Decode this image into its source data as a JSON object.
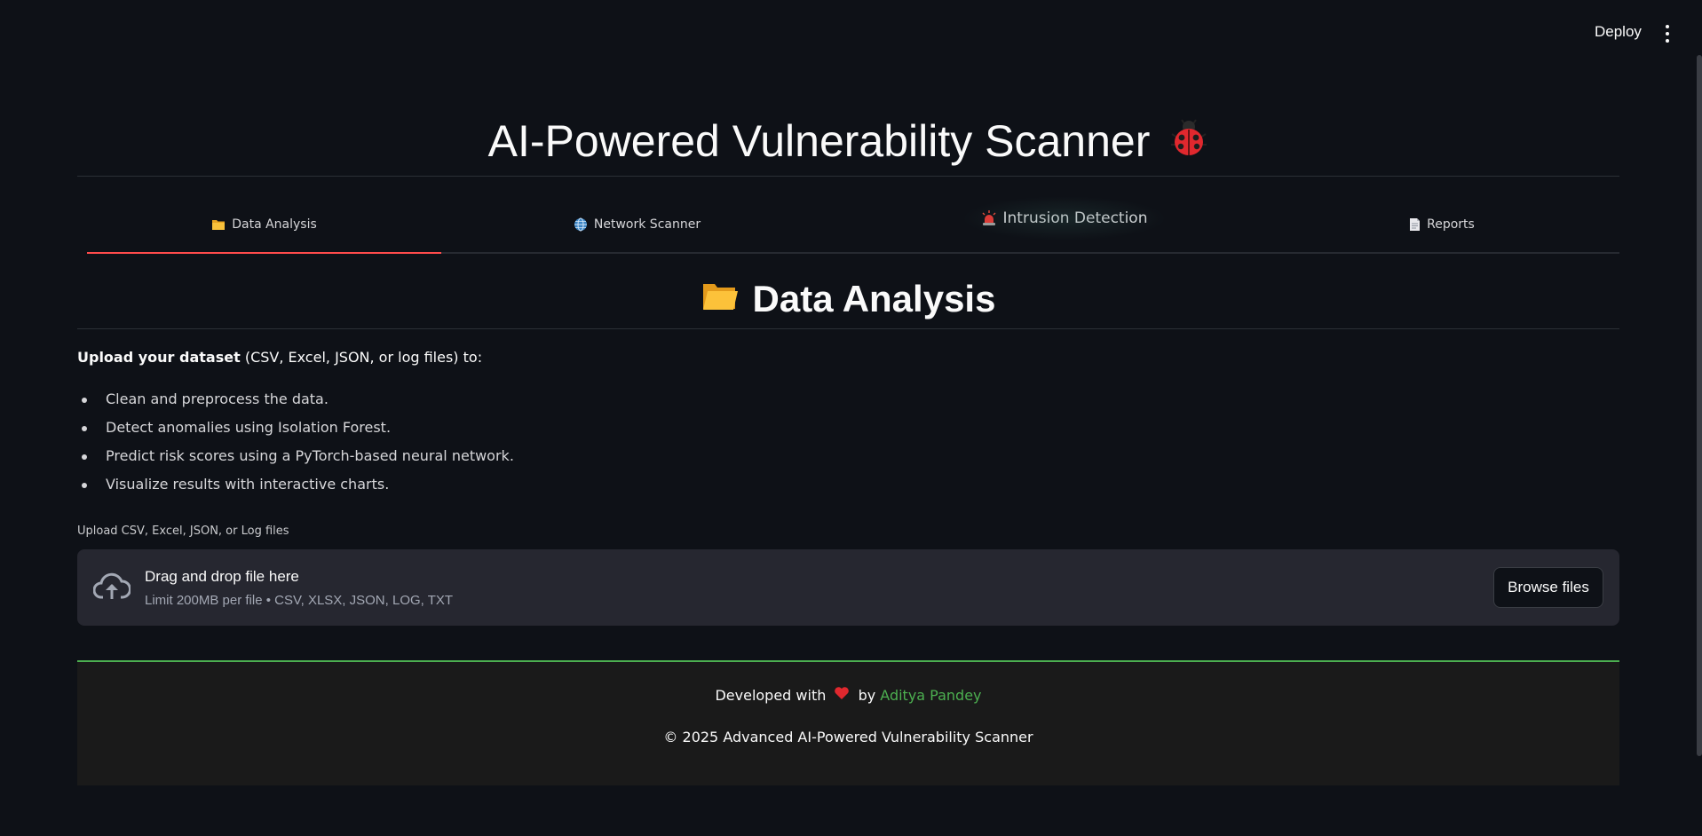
{
  "header": {
    "deploy_label": "Deploy"
  },
  "page": {
    "title": "AI-Powered Vulnerability Scanner"
  },
  "tabs": [
    {
      "label": "Data Analysis",
      "icon": "folder-icon",
      "active": true
    },
    {
      "label": "Network Scanner",
      "icon": "globe-icon",
      "active": false
    },
    {
      "label": "Intrusion Detection",
      "icon": "siren-icon",
      "active": false
    },
    {
      "label": "Reports",
      "icon": "document-icon",
      "active": false
    }
  ],
  "section": {
    "heading": "Data Analysis",
    "intro_bold": "Upload your dataset",
    "intro_rest": " (CSV, Excel, JSON, or log files) to:",
    "bullets": [
      "Clean and preprocess the data.",
      "Detect anomalies using Isolation Forest.",
      "Predict risk scores using a PyTorch-based neural network.",
      "Visualize results with interactive charts."
    ]
  },
  "uploader": {
    "label": "Upload CSV, Excel, JSON, or Log files",
    "drop_title": "Drag and drop file here",
    "drop_sub": "Limit 200MB per file • CSV, XLSX, JSON, LOG, TXT",
    "browse_label": "Browse files"
  },
  "footer": {
    "developed_prefix": "Developed with",
    "developed_by": "by",
    "author": "Aditya Pandey",
    "copyright": "© 2025 Advanced AI-Powered Vulnerability Scanner"
  },
  "colors": {
    "background": "#0e1117",
    "accent_tab": "#ff4b4b",
    "footer_accent": "#4caf50",
    "dropzone_bg": "#262730"
  }
}
